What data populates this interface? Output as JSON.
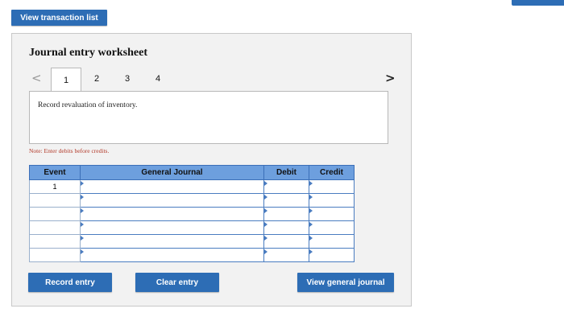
{
  "header": {
    "view_transaction_list_label": "View transaction list"
  },
  "worksheet": {
    "title": "Journal entry worksheet",
    "pager": {
      "prev_glyph": "<",
      "next_glyph": ">",
      "tabs": [
        "1",
        "2",
        "3",
        "4"
      ],
      "active_tab": "1"
    },
    "instruction": "Record revaluation of inventory.",
    "note": "Note: Enter debits before credits.",
    "table": {
      "headers": [
        "Event",
        "General Journal",
        "Debit",
        "Credit"
      ],
      "rows": [
        {
          "event": "1",
          "general_journal": "",
          "debit": "",
          "credit": ""
        },
        {
          "event": "",
          "general_journal": "",
          "debit": "",
          "credit": ""
        },
        {
          "event": "",
          "general_journal": "",
          "debit": "",
          "credit": ""
        },
        {
          "event": "",
          "general_journal": "",
          "debit": "",
          "credit": ""
        },
        {
          "event": "",
          "general_journal": "",
          "debit": "",
          "credit": ""
        },
        {
          "event": "",
          "general_journal": "",
          "debit": "",
          "credit": ""
        }
      ]
    },
    "buttons": {
      "record_entry": "Record entry",
      "clear_entry": "Clear entry",
      "view_general_journal": "View general journal"
    }
  },
  "colors": {
    "accent_button": "#2d6db5",
    "table_header": "#6d9fde",
    "note_text": "#b23a2a"
  }
}
